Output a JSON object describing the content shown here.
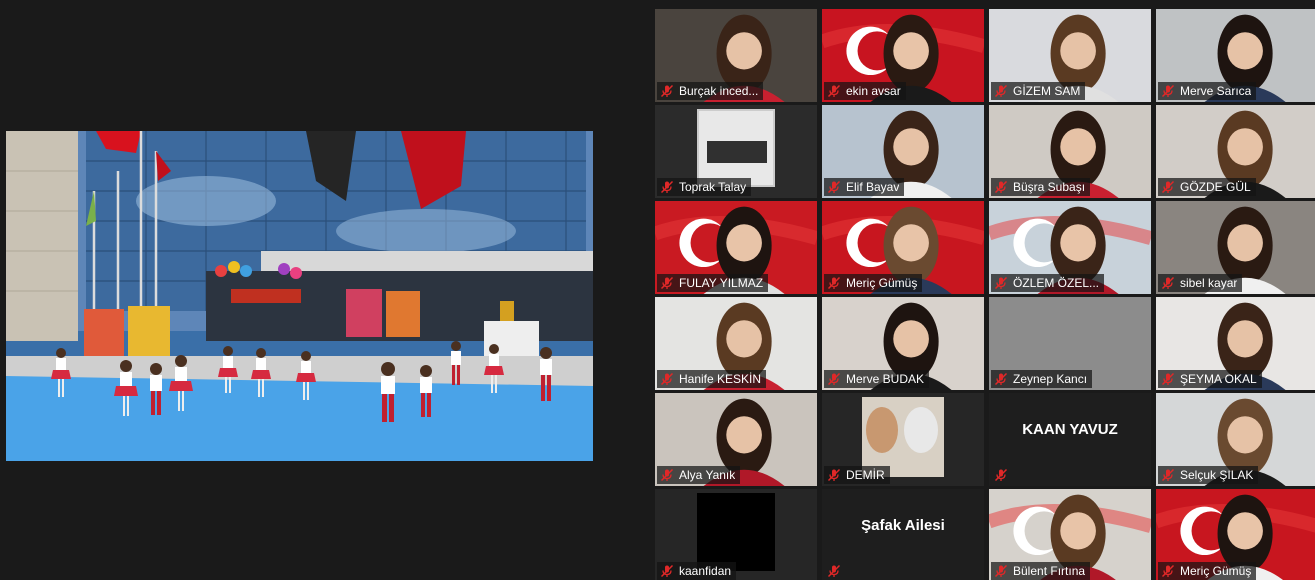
{
  "colors": {
    "background": "#1a1a1a",
    "active_speaker_border": "#c6d84a",
    "mute_icon": "#e02828",
    "flag_red": "#d8121e"
  },
  "icons": {
    "muted": "microphone-muted-icon"
  },
  "shared_screen": {
    "description_icon": "video-stream"
  },
  "participants": [
    {
      "name": "Burçak incedere",
      "display": "Burçak inced...",
      "video": "person",
      "bg": "#4a443e",
      "muted": true
    },
    {
      "name": "ekin avsar",
      "display": "ekin avsar",
      "video": "flag-person",
      "bg": "#c81420",
      "muted": true,
      "active": true
    },
    {
      "name": "GİZEM SAM",
      "display": "GİZEM SAM",
      "video": "person",
      "bg": "#d9dade",
      "muted": true
    },
    {
      "name": "Merve Sarıca",
      "display": "Merve Sarıca",
      "video": "person",
      "bg": "#bfc2c4",
      "muted": true
    },
    {
      "name": "Toprak Talay",
      "display": "Toprak Talay",
      "video": "album",
      "bg": "#2b2b2b",
      "muted": true
    },
    {
      "name": "Elif Bayav",
      "display": "Elif Bayav",
      "video": "person",
      "bg": "#b7c3cf",
      "muted": true
    },
    {
      "name": "Büşra Subaşı",
      "display": "Büşra Subaşı",
      "video": "person",
      "bg": "#cfcac4",
      "muted": true
    },
    {
      "name": "GÖZDE GÜL",
      "display": "GÖZDE GÜL",
      "video": "person",
      "bg": "#d2cdc8",
      "muted": true
    },
    {
      "name": "FULAY YILMAZ",
      "display": "FULAY YILMAZ",
      "video": "flag-person",
      "bg": "#c91a22",
      "muted": true
    },
    {
      "name": "Meriç Gümüş",
      "display": "Meriç Gümüş",
      "video": "flag-person",
      "bg": "#c8161f",
      "muted": true
    },
    {
      "name": "ÖZLEM ÖZELÇİ",
      "display": "ÖZLEM ÖZEL...",
      "video": "flag-person",
      "bg": "#c8d2da",
      "muted": true
    },
    {
      "name": "sibel kayar",
      "display": "sibel kayar",
      "video": "person",
      "bg": "#8a8580",
      "muted": true
    },
    {
      "name": "Hanife KESKİN",
      "display": "Hanife KESKİN",
      "video": "person",
      "bg": "#e4e4e2",
      "muted": true
    },
    {
      "name": "Merve BUDAK",
      "display": "Merve BUDAK",
      "video": "person",
      "bg": "#d8d2cc",
      "muted": true
    },
    {
      "name": "Zeynep Kancı",
      "display": "Zeynep Kancı",
      "video": "blank",
      "bg": "#8c8c8c",
      "muted": true
    },
    {
      "name": "ŞEYMA OKAL",
      "display": "ŞEYMA OKAL",
      "video": "person",
      "bg": "#e8e6e4",
      "muted": true
    },
    {
      "name": "Alya Yanık",
      "display": "Alya Yanık",
      "video": "person",
      "bg": "#cac4bd",
      "muted": true
    },
    {
      "name": "DEMİR",
      "display": "DEMİR",
      "video": "avatar",
      "bg": "#262626",
      "muted": true
    },
    {
      "name": "KAAN YAVUZ",
      "display": "",
      "title": "KAAN YAVUZ",
      "video": "off",
      "bg": "#1e1e1e",
      "muted": true
    },
    {
      "name": "Selçuk ŞILAK",
      "display": "Selçuk ŞILAK",
      "video": "person",
      "bg": "#d5d7d8",
      "muted": true
    },
    {
      "name": "kaanfidan",
      "display": "kaanfidan",
      "video": "black-avatar",
      "bg": "#262626",
      "muted": true
    },
    {
      "name": "Şafak Ailesi",
      "display": "",
      "title": "Şafak Ailesi",
      "video": "off",
      "bg": "#1e1e1e",
      "muted": true
    },
    {
      "name": "Bülent Fırtına",
      "display": "Bülent Fırtına",
      "video": "flag-person",
      "bg": "#d6d2cc",
      "muted": true
    },
    {
      "name": "Meriç Gümüş",
      "display": "Meriç Gümüş",
      "video": "flag-person",
      "bg": "#c8161f",
      "muted": true
    }
  ]
}
